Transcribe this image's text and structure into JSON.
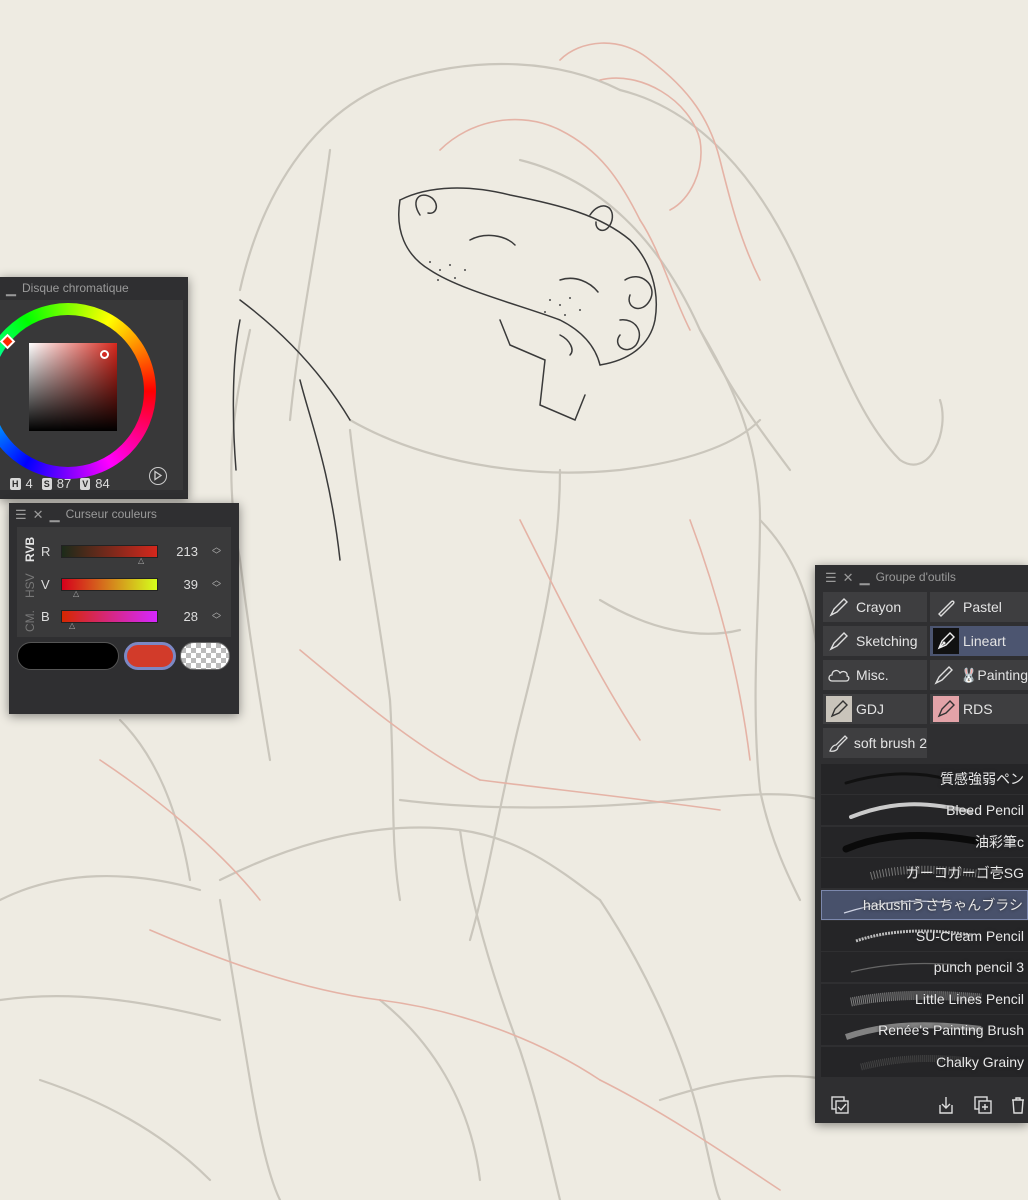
{
  "color_wheel": {
    "title": "Disque chromatique",
    "h_label": "H",
    "h_value": "4",
    "s_label": "S",
    "s_value": "87",
    "v_label": "V",
    "v_value": "84"
  },
  "color_sliders": {
    "title": "Curseur couleurs",
    "tabs": [
      "RVB",
      "HSV",
      "CM."
    ],
    "channels": [
      {
        "label": "R",
        "value": "213"
      },
      {
        "label": "V",
        "value": "39"
      },
      {
        "label": "B",
        "value": "28"
      }
    ],
    "swatches": {
      "main": "#000000",
      "sub": "#d5271c",
      "transparent": "checker"
    }
  },
  "tool_group": {
    "title": "Groupe d'outils",
    "groups": [
      {
        "label": "Crayon",
        "icon": "pencil-icon"
      },
      {
        "label": "Pastel",
        "icon": "pastel-icon"
      },
      {
        "label": "Sketching",
        "icon": "pencil-icon"
      },
      {
        "label": "Lineart",
        "icon": "pen-nib-icon",
        "selected": true
      },
      {
        "label": "Misc.",
        "icon": "cloud-icon"
      },
      {
        "label": "🐰Painting",
        "icon": "pencil-icon"
      },
      {
        "label": "GDJ",
        "icon": "pen-nib-icon"
      },
      {
        "label": "RDS",
        "icon": "pen-nib-icon"
      },
      {
        "label": "soft brush 2",
        "icon": "brush-icon"
      }
    ],
    "brushes": [
      {
        "name": "質感強弱ペン"
      },
      {
        "name": "Bleed Pencil"
      },
      {
        "name": "油彩筆c"
      },
      {
        "name": "ガーコガーゴ壱SG"
      },
      {
        "name": "hakushiうさちゃんブラシ",
        "selected": true
      },
      {
        "name": "SU-Cream Pencil"
      },
      {
        "name": "punch pencil 3"
      },
      {
        "name": "Little Lines Pencil"
      },
      {
        "name": "Renée's Painting Brush"
      },
      {
        "name": "Chalky Grainy"
      }
    ]
  }
}
